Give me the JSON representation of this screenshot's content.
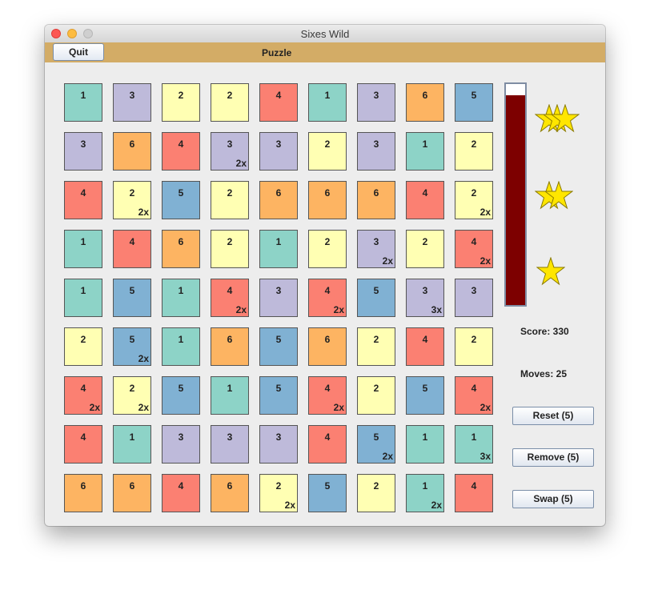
{
  "window": {
    "title": "Sixes Wild"
  },
  "menubar": {
    "quit_label": "Quit",
    "title": "Puzzle"
  },
  "colors": {
    "1": "#8dd3c7",
    "2": "#ffffb3",
    "3": "#bebada",
    "4": "#fb8072",
    "5": "#80b1d3",
    "6": "#fdb462",
    "meter_fill": "#7d0000",
    "star": "#ffe600"
  },
  "board": {
    "rows": [
      [
        {
          "v": "1"
        },
        {
          "v": "3"
        },
        {
          "v": "2"
        },
        {
          "v": "2"
        },
        {
          "v": "4"
        },
        {
          "v": "1"
        },
        {
          "v": "3"
        },
        {
          "v": "6"
        },
        {
          "v": "5"
        }
      ],
      [
        {
          "v": "3"
        },
        {
          "v": "6"
        },
        {
          "v": "4"
        },
        {
          "v": "3",
          "m": "2x"
        },
        {
          "v": "3"
        },
        {
          "v": "2"
        },
        {
          "v": "3"
        },
        {
          "v": "1"
        },
        {
          "v": "2"
        }
      ],
      [
        {
          "v": "4"
        },
        {
          "v": "2",
          "m": "2x"
        },
        {
          "v": "5"
        },
        {
          "v": "2"
        },
        {
          "v": "6"
        },
        {
          "v": "6"
        },
        {
          "v": "6"
        },
        {
          "v": "4"
        },
        {
          "v": "2",
          "m": "2x"
        }
      ],
      [
        {
          "v": "1"
        },
        {
          "v": "4"
        },
        {
          "v": "6"
        },
        {
          "v": "2"
        },
        {
          "v": "1"
        },
        {
          "v": "2"
        },
        {
          "v": "3",
          "m": "2x"
        },
        {
          "v": "2"
        },
        {
          "v": "4",
          "m": "2x"
        }
      ],
      [
        {
          "v": "1"
        },
        {
          "v": "5"
        },
        {
          "v": "1"
        },
        {
          "v": "4",
          "m": "2x"
        },
        {
          "v": "3"
        },
        {
          "v": "4",
          "m": "2x"
        },
        {
          "v": "5"
        },
        {
          "v": "3",
          "m": "3x"
        },
        {
          "v": "3"
        }
      ],
      [
        {
          "v": "2"
        },
        {
          "v": "5",
          "m": "2x"
        },
        {
          "v": "1"
        },
        {
          "v": "6"
        },
        {
          "v": "5"
        },
        {
          "v": "6"
        },
        {
          "v": "2"
        },
        {
          "v": "4"
        },
        {
          "v": "2"
        }
      ],
      [
        {
          "v": "4",
          "m": "2x"
        },
        {
          "v": "2",
          "m": "2x"
        },
        {
          "v": "5"
        },
        {
          "v": "1"
        },
        {
          "v": "5"
        },
        {
          "v": "4",
          "m": "2x"
        },
        {
          "v": "2"
        },
        {
          "v": "5"
        },
        {
          "v": "4",
          "m": "2x"
        }
      ],
      [
        {
          "v": "4"
        },
        {
          "v": "1"
        },
        {
          "v": "3"
        },
        {
          "v": "3"
        },
        {
          "v": "3"
        },
        {
          "v": "4"
        },
        {
          "v": "5",
          "m": "2x"
        },
        {
          "v": "1"
        },
        {
          "v": "1",
          "m": "3x"
        }
      ],
      [
        {
          "v": "6"
        },
        {
          "v": "6"
        },
        {
          "v": "4"
        },
        {
          "v": "6"
        },
        {
          "v": "2",
          "m": "2x"
        },
        {
          "v": "5"
        },
        {
          "v": "2"
        },
        {
          "v": "1",
          "m": "2x"
        },
        {
          "v": "4"
        }
      ]
    ]
  },
  "progress": {
    "fill_fraction": 0.95
  },
  "stars": [
    {
      "name": "three-stars-icon",
      "count": 3
    },
    {
      "name": "two-stars-icon",
      "count": 2
    },
    {
      "name": "one-star-icon",
      "count": 1
    }
  ],
  "status": {
    "score_label": "Score: 330",
    "moves_label": "Moves: 25"
  },
  "buttons": {
    "reset_label": "Reset (5)",
    "remove_label": "Remove (5)",
    "swap_label": "Swap (5)"
  }
}
